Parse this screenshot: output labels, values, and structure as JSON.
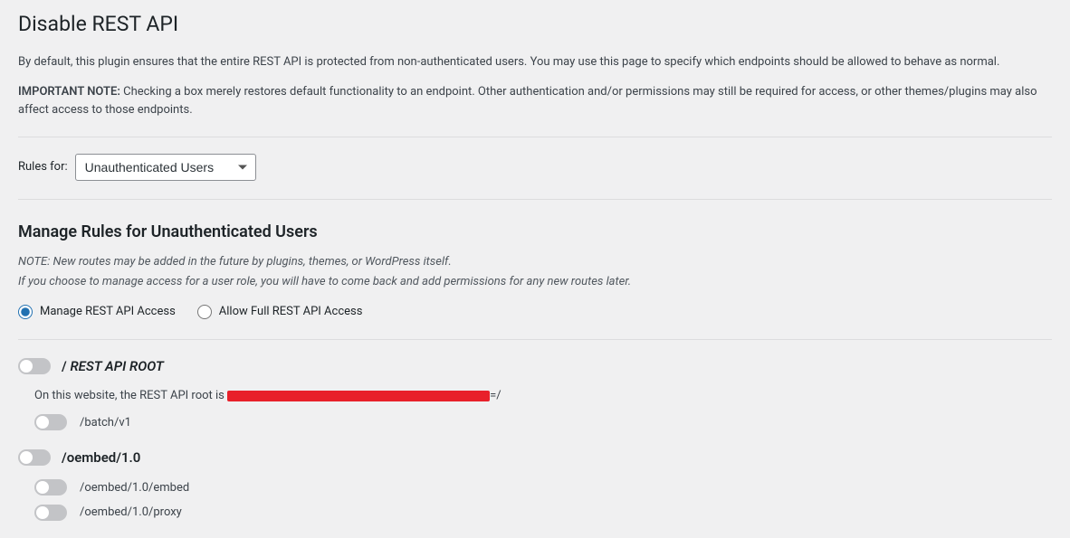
{
  "page_title": "Disable REST API",
  "intro_paragraph": "By default, this plugin ensures that the entire REST API is protected from non-authenticated users. You may use this page to specify which endpoints should be allowed to behave as normal.",
  "important_note_label": "IMPORTANT NOTE:",
  "important_note_text": " Checking a box merely restores default functionality to an endpoint. Other authentication and/or permissions may still be required for access, or other themes/plugins may also affect access to those endpoints.",
  "rules_for_label": "Rules for:",
  "rules_for_options": [
    "Unauthenticated Users"
  ],
  "rules_for_selected": "Unauthenticated Users",
  "manage_heading": "Manage Rules for Unauthenticated Users",
  "note_line1": "NOTE: New routes may be added in the future by plugins, themes, or WordPress itself.",
  "note_line2": "If you choose to manage access for a user role, you will have to come back and add permissions for any new routes later.",
  "radio_manage_label": "Manage REST API Access",
  "radio_allow_label": "Allow Full REST API Access",
  "radio_selected": "manage",
  "root_group": {
    "toggle_on": false,
    "label_prefix": "/ ",
    "label_italic": "REST API ROOT",
    "description_prefix": "On this website, the REST API root is ",
    "description_suffix": "=/",
    "sub_routes": [
      {
        "toggle_on": false,
        "label": "/batch/v1"
      }
    ]
  },
  "oembed_group": {
    "toggle_on": false,
    "label": "/oembed/1.0",
    "sub_routes": [
      {
        "toggle_on": false,
        "label": "/oembed/1.0/embed"
      },
      {
        "toggle_on": false,
        "label": "/oembed/1.0/proxy"
      }
    ]
  }
}
